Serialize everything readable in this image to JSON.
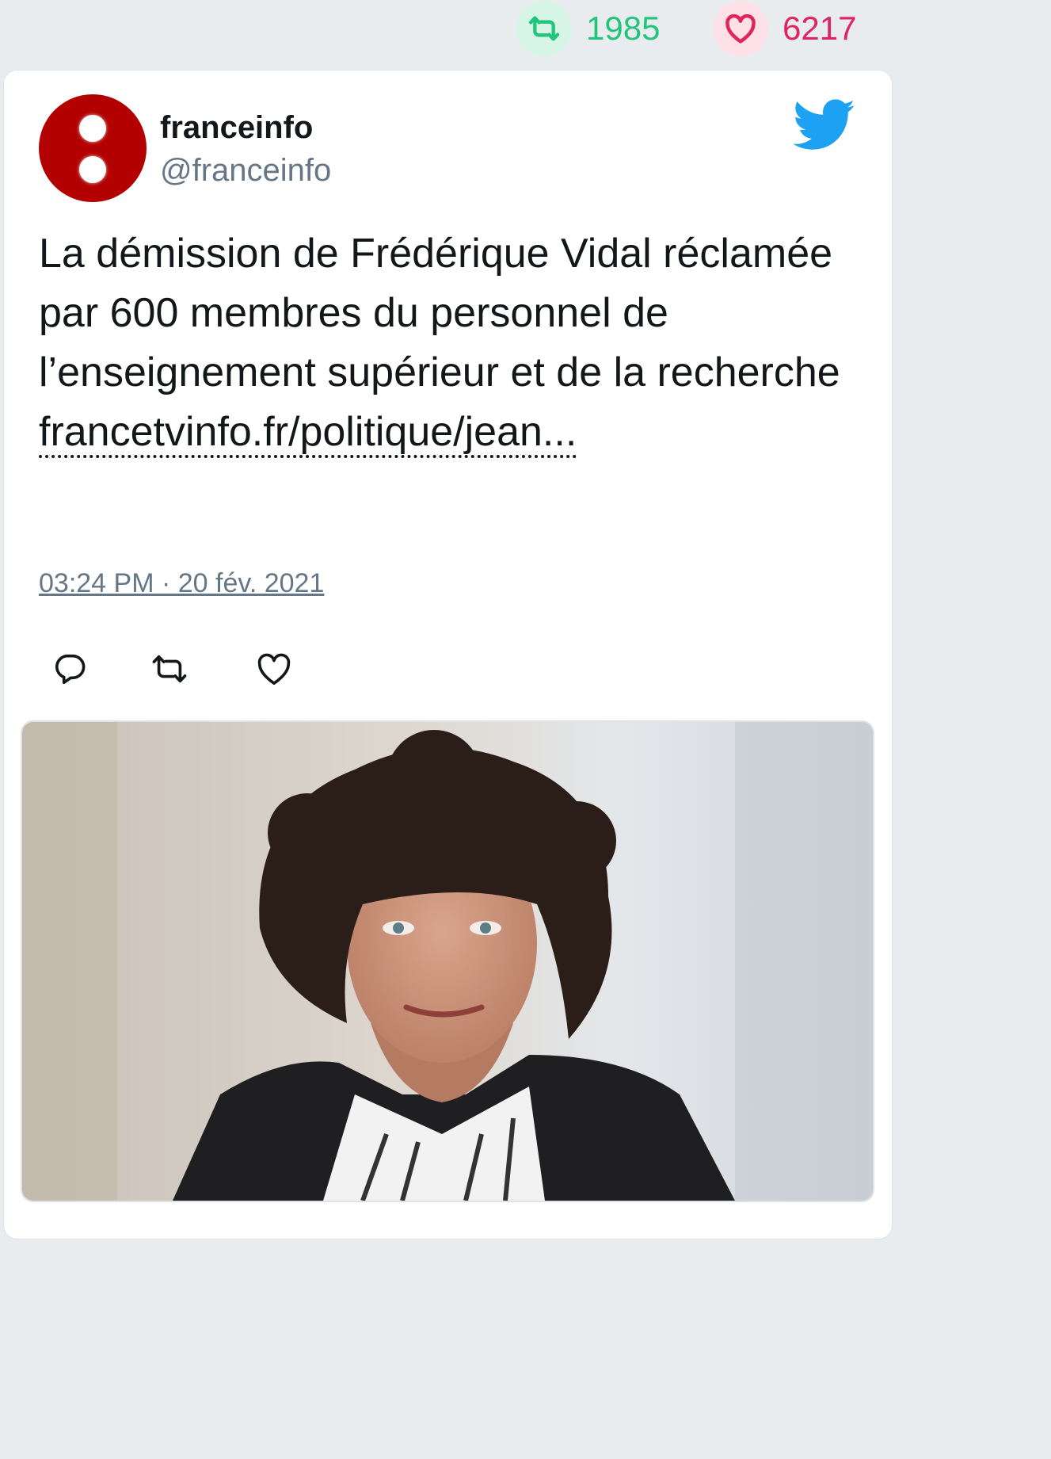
{
  "stats": {
    "retweets": "1985",
    "likes": "6217",
    "retweet_icon": "retweet-icon",
    "like_icon": "heart-icon",
    "retweet_color": "#22c57a",
    "like_color": "#e0245e"
  },
  "tweet": {
    "author_name": "franceinfo",
    "author_handle": "@franceinfo",
    "text": "La démission de Frédérique Vidal réclamée par 600 membres du personnel de l’enseignement supérieur et de la recherche",
    "link_text": "francetvinfo.fr/politique/jean...",
    "timestamp": "03:24 PM · 20 fév. 2021",
    "avatar_color": "#b30000",
    "brand_icon": "twitter-bird-icon",
    "brand_color": "#1da1f2"
  },
  "actions": {
    "reply_icon": "reply-icon",
    "retweet_icon": "retweet-icon",
    "like_icon": "heart-icon"
  },
  "media": {
    "type": "photo"
  }
}
